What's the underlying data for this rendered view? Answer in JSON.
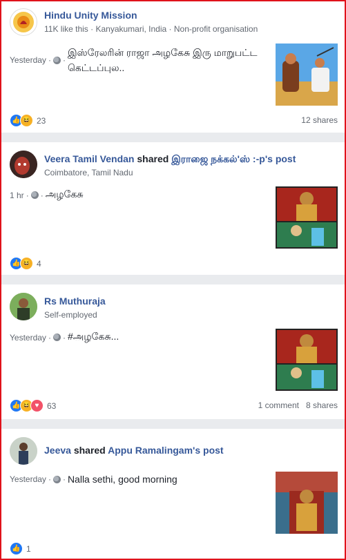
{
  "posts": [
    {
      "author": "Hindu Unity Mission",
      "sub": "11K like this · Kanyakumari, India · Non-profit organisation",
      "time": "Yesterday",
      "text": "இஸ்ரேலரின் ராஜா அழகேசு இரு மாறுபட்ட கெட்டப்புல..",
      "react_icons": [
        "like-icon",
        "haha-icon"
      ],
      "react_count": "23",
      "shares": "12 shares",
      "comments": ""
    },
    {
      "author": "Veera Tamil Vendan",
      "shared_word": "shared",
      "shared_of": "இராஜை நக்கல்'ஸ் :-p's post",
      "sub": "Coimbatore, Tamil Nadu",
      "time": "1 hr",
      "text": "அழகேசு",
      "react_icons": [
        "like-icon",
        "haha-icon"
      ],
      "react_count": "4"
    },
    {
      "author": "Rs Muthuraja",
      "sub": "Self-employed",
      "time": "Yesterday",
      "text": "#அழகேசு...",
      "react_icons": [
        "like-icon",
        "haha-icon",
        "love-icon"
      ],
      "react_count": "63",
      "comments": "1 comment",
      "shares": "8 shares"
    },
    {
      "author": "Jeeva",
      "shared_word": "shared",
      "shared_of": "Appu Ramalingam's post",
      "time": "Yesterday",
      "text": "Nalla sethi, good morning",
      "react_icons": [
        "like-icon"
      ],
      "react_count": "1"
    }
  ],
  "colors": {
    "link": "#365899",
    "like": "#2078f4",
    "haha": "#f7b125",
    "love": "#f25268",
    "border": "#e0121b"
  }
}
